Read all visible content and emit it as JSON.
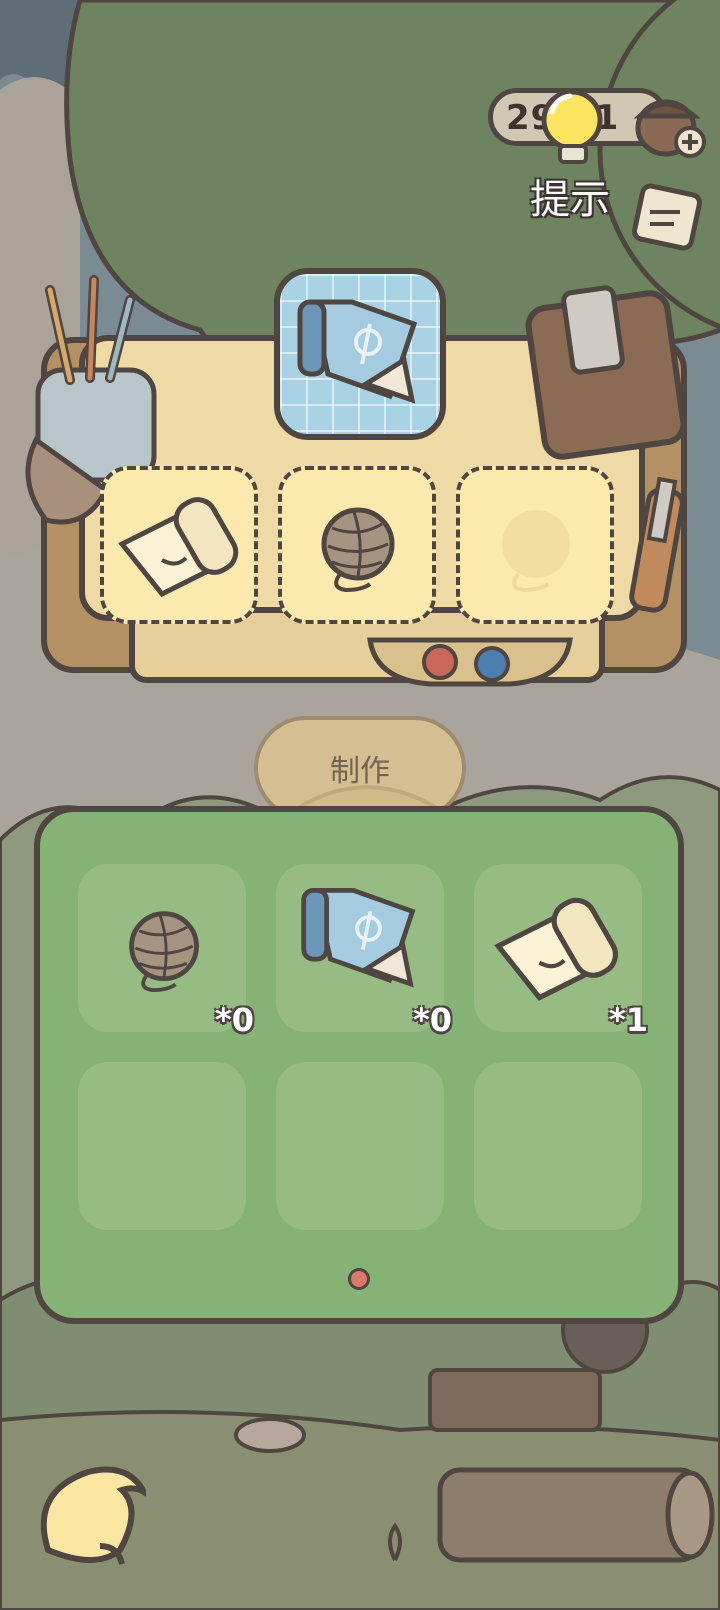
{
  "hud": {
    "counter_text": "29:21",
    "hint_label": "提示",
    "icons": [
      "lightbulb-icon",
      "acorn-icon",
      "plus-icon",
      "note-icon"
    ]
  },
  "workbench": {
    "recipe_item": "blueprint",
    "craft_slots": [
      {
        "item": "paper-scroll",
        "filled": true
      },
      {
        "item": "yarn-ball",
        "filled": true
      },
      {
        "item": "yarn-ball",
        "filled": false
      }
    ]
  },
  "craft_button": {
    "label": "制作",
    "enabled": false
  },
  "inventory": {
    "items": [
      {
        "item": "yarn-ball",
        "count": "*0"
      },
      {
        "item": "blueprint",
        "count": "*0"
      },
      {
        "item": "paper-scroll",
        "count": "*1"
      }
    ],
    "page": 1,
    "page_count": 1
  },
  "colors": {
    "outline": "#4f4541",
    "panel_green": "#86b275",
    "slot_yellow": "#fbe9ae",
    "table_wood": "#efd9a4",
    "blueprint_blue": "#a9d3e4"
  },
  "back_button_icon": "banana-leaf-back-icon"
}
